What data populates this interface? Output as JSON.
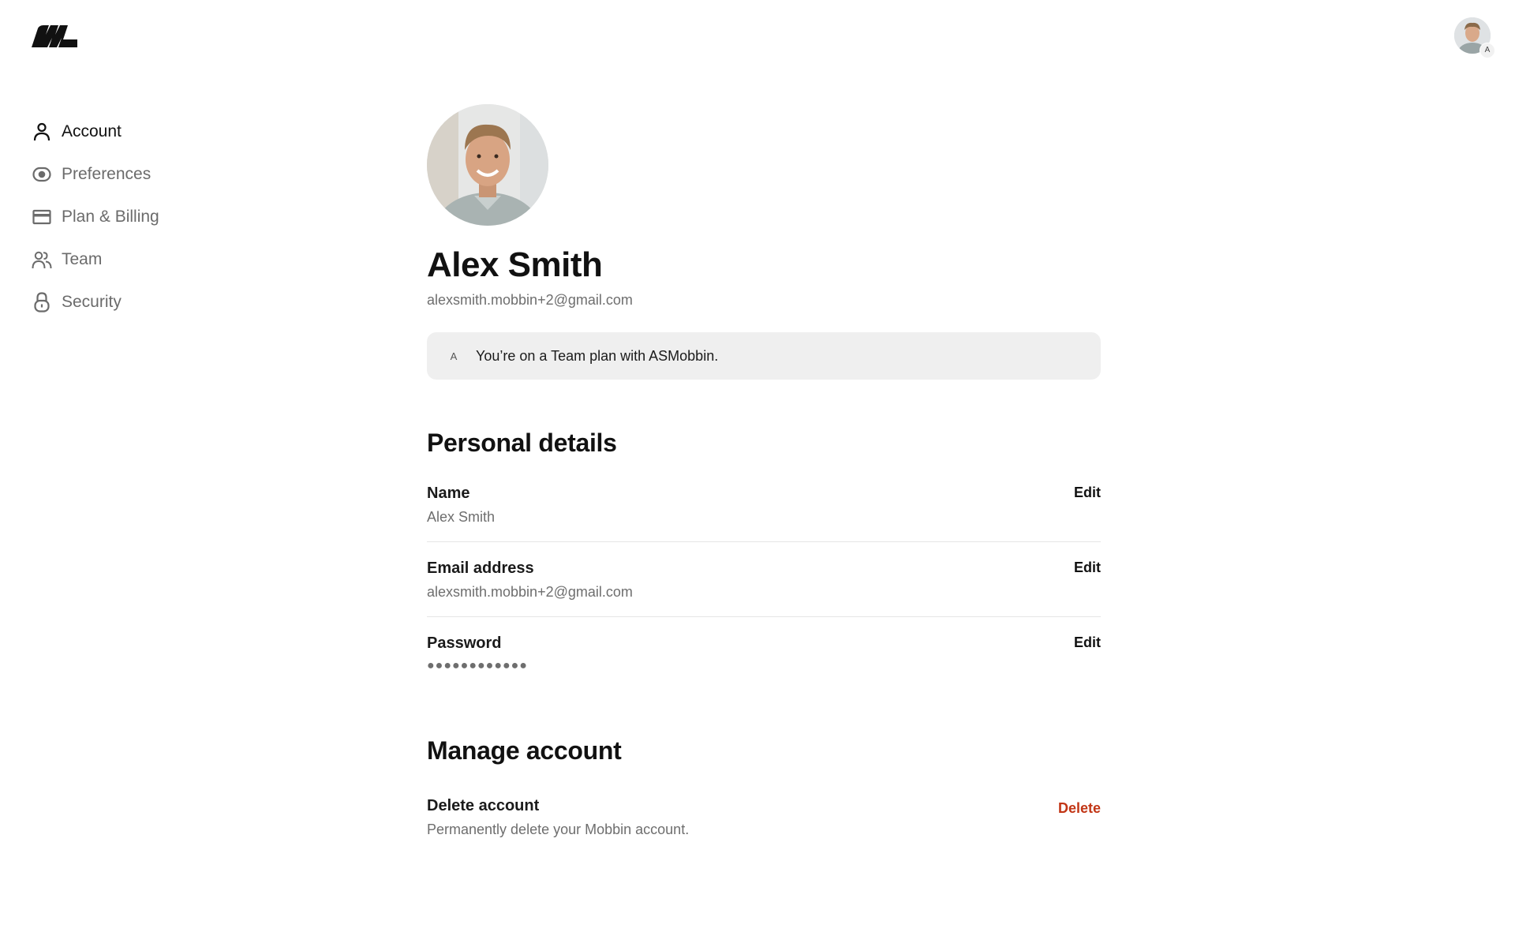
{
  "header": {
    "logo_icon": "mobbin-logo-icon",
    "avatar_badge": "A"
  },
  "sidebar": {
    "items": [
      {
        "label": "Account",
        "icon": "user-icon",
        "active": true
      },
      {
        "label": "Preferences",
        "icon": "eye-icon",
        "active": false
      },
      {
        "label": "Plan & Billing",
        "icon": "credit-card-icon",
        "active": false
      },
      {
        "label": "Team",
        "icon": "users-icon",
        "active": false
      },
      {
        "label": "Security",
        "icon": "lock-icon",
        "active": false
      }
    ]
  },
  "profile": {
    "name": "Alex Smith",
    "email": "alexsmith.mobbin+2@gmail.com",
    "plan_badge": "A",
    "plan_text": "You’re on a Team plan with ASMobbin."
  },
  "personal_details": {
    "title": "Personal details",
    "rows": [
      {
        "label": "Name",
        "value": "Alex Smith",
        "action": "Edit"
      },
      {
        "label": "Email address",
        "value": "alexsmith.mobbin+2@gmail.com",
        "action": "Edit"
      },
      {
        "label": "Password",
        "value": "●●●●●●●●●●●●",
        "action": "Edit"
      }
    ]
  },
  "manage_account": {
    "title": "Manage account",
    "delete_label": "Delete account",
    "delete_description": "Permanently delete your Mobbin account.",
    "delete_action": "Delete",
    "danger_color": "#c23616"
  }
}
